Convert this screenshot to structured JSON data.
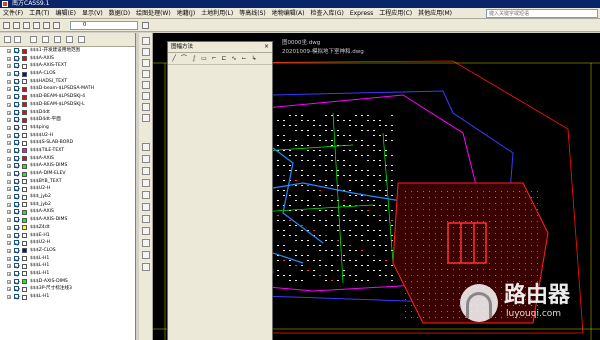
{
  "window": {
    "title": "南方CASS9.1"
  },
  "menubar": {
    "items": [
      "文件(F)",
      "工具(T)",
      "编辑(E)",
      "显示(V)",
      "数据(D)",
      "绘图处理(W)",
      "地籍(J)",
      "土地利用(L)",
      "等高线(S)",
      "地物编辑(A)",
      "检查入库(G)",
      "Express",
      "工程应用(C)",
      "其他应用(M)"
    ],
    "search_placeholder": "键入关键字或短语"
  },
  "toolbar": {
    "layer_value": "0"
  },
  "layers": [
    {
      "name": "$$$1-开发建设用地范围",
      "color": "#ff0000"
    },
    {
      "name": "$$$A-AXIS",
      "color": "#ff0000"
    },
    {
      "name": "$$$A-AXIS-TEXT",
      "color": "#ffffff"
    },
    {
      "name": "$$$A-CLOS",
      "color": "#0000ff"
    },
    {
      "name": "$$$HADSI_TEXT",
      "color": "#ffffff"
    },
    {
      "name": "$$$D-beam-$LPSDSA-MATH",
      "color": "#ff0000"
    },
    {
      "name": "$$$D-BEAM-$LPSDSKJ-4",
      "color": "#ff0000"
    },
    {
      "name": "$$$D-BEAM-$LPSDSKJ-L",
      "color": "#ff0000"
    },
    {
      "name": "$$$D4dt",
      "color": "#ff0000"
    },
    {
      "name": "$$$D4dt-平面",
      "color": "#ff0000"
    },
    {
      "name": "$$$ping",
      "color": "#ffffff"
    },
    {
      "name": "$$$$U2-H",
      "color": "#ffffff"
    },
    {
      "name": "$$$$S-SLAB-BORD",
      "color": "#ffffff"
    },
    {
      "name": "$$$$TILE-TEXT",
      "color": "#ff00ff"
    },
    {
      "name": "$$$A-AXIS",
      "color": "#ff0000"
    },
    {
      "name": "$$$A-AXIS-DIMS",
      "color": "#00ff00"
    },
    {
      "name": "$$$A-DIM-ELEV",
      "color": "#00ff00"
    },
    {
      "name": "$$$BYB_TEXT",
      "color": "#ffffff"
    },
    {
      "name": "$$$U2-H",
      "color": "#ffffff"
    },
    {
      "name": "$$$_jyb2",
      "color": "#ffffff"
    },
    {
      "name": "$$$_jyb2",
      "color": "#ffffff"
    },
    {
      "name": "$$$A-AXIS",
      "color": "#00ff00"
    },
    {
      "name": "$$$A-AXIS-DIMS",
      "color": "#00ff00"
    },
    {
      "name": "$$$Z4dt",
      "color": "#ffff00"
    },
    {
      "name": "$$$E-H1",
      "color": "#ffffff"
    },
    {
      "name": "$$$U2-H",
      "color": "#ffffff"
    },
    {
      "name": "$$$Z-CLOS",
      "color": "#0000ff"
    },
    {
      "name": "$$$L-H1",
      "color": "#ffffff"
    },
    {
      "name": "$$$L-H1",
      "color": "#ffffff"
    },
    {
      "name": "$$$L-H1",
      "color": "#ffffff"
    },
    {
      "name": "$$$D-AXIS-DIMS",
      "color": "#00ff00"
    },
    {
      "name": "$$$3P-尺寸标注线3",
      "color": "#ffffff"
    },
    {
      "name": "$$$L-H1",
      "color": "#ffffff"
    }
  ],
  "float_dialog": {
    "title": "图幅方法"
  },
  "tabs": [
    {
      "label": "图0000坐.dwg"
    },
    {
      "label": "20201009-模拟地下室神和.dwg"
    }
  ],
  "watermark": {
    "title": "路由器",
    "url": "luyouqi.com"
  }
}
